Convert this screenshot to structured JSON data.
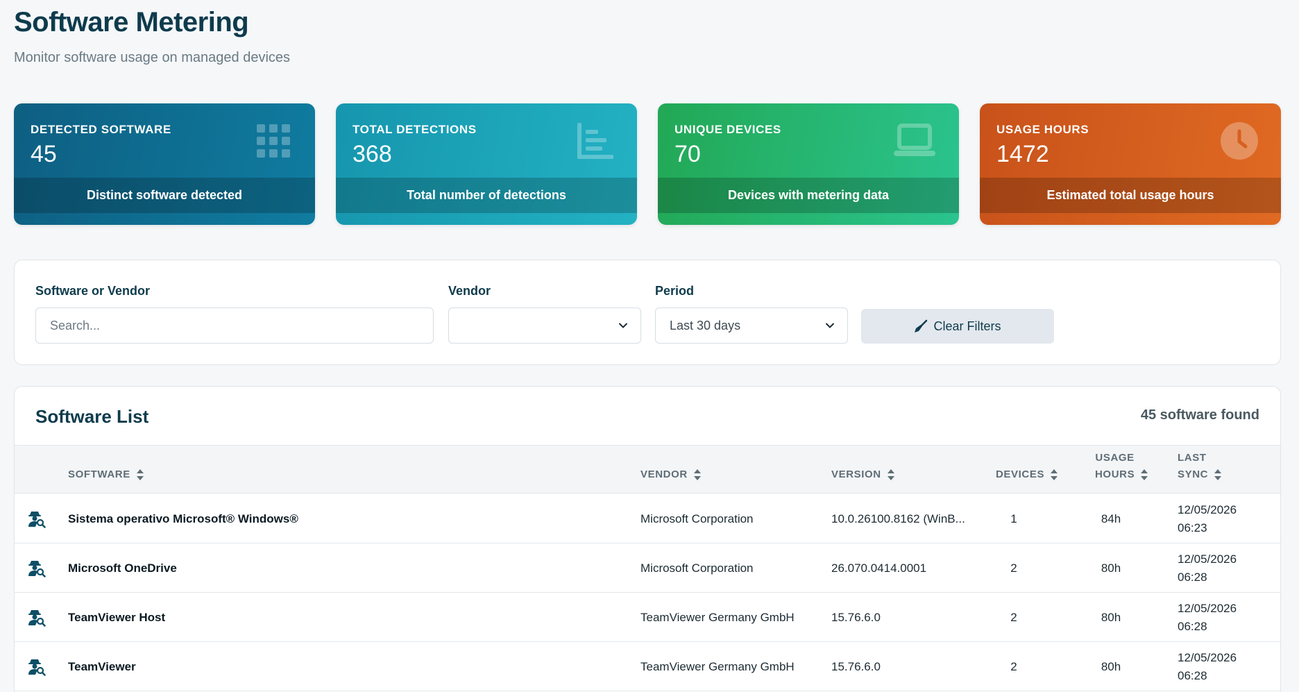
{
  "header": {
    "title": "Software Metering",
    "subtitle": "Monitor software usage on managed devices"
  },
  "cards": [
    {
      "label": "DETECTED SOFTWARE",
      "value": "45",
      "caption": "Distinct software detected",
      "icon": "grid-icon"
    },
    {
      "label": "TOTAL DETECTIONS",
      "value": "368",
      "caption": "Total number of detections",
      "icon": "chart-list-icon"
    },
    {
      "label": "UNIQUE DEVICES",
      "value": "70",
      "caption": "Devices with metering data",
      "icon": "laptop-icon"
    },
    {
      "label": "USAGE HOURS",
      "value": "1472",
      "caption": "Estimated total usage hours",
      "icon": "clock-icon"
    }
  ],
  "filters": {
    "search_label": "Software or Vendor",
    "search_placeholder": "Search...",
    "vendor_label": "Vendor",
    "vendor_value": "",
    "period_label": "Period",
    "period_value": "Last 30 days",
    "clear_label": "Clear Filters"
  },
  "list": {
    "title": "Software List",
    "count_text": "45 software found",
    "columns": {
      "software": "SOFTWARE",
      "vendor": "VENDOR",
      "version": "VERSION",
      "devices": "DEVICES",
      "usage_line1": "USAGE",
      "usage_line2": "HOURS",
      "sync_line1": "LAST",
      "sync_line2": "SYNC"
    },
    "rows": [
      {
        "name": "Sistema operativo Microsoft® Windows®",
        "vendor": "Microsoft Corporation",
        "version": "10.0.26100.8162 (WinB...",
        "devices": "1",
        "hours": "84h",
        "sync_date": "12/05/2026",
        "sync_time": "06:23"
      },
      {
        "name": "Microsoft OneDrive",
        "vendor": "Microsoft Corporation",
        "version": "26.070.0414.0001",
        "devices": "2",
        "hours": "80h",
        "sync_date": "12/05/2026",
        "sync_time": "06:28"
      },
      {
        "name": "TeamViewer Host",
        "vendor": "TeamViewer Germany GmbH",
        "version": "15.76.6.0",
        "devices": "2",
        "hours": "80h",
        "sync_date": "12/05/2026",
        "sync_time": "06:28"
      },
      {
        "name": "TeamViewer",
        "vendor": "TeamViewer Germany GmbH",
        "version": "15.76.6.0",
        "devices": "2",
        "hours": "80h",
        "sync_date": "12/05/2026",
        "sync_time": "06:28"
      }
    ]
  }
}
